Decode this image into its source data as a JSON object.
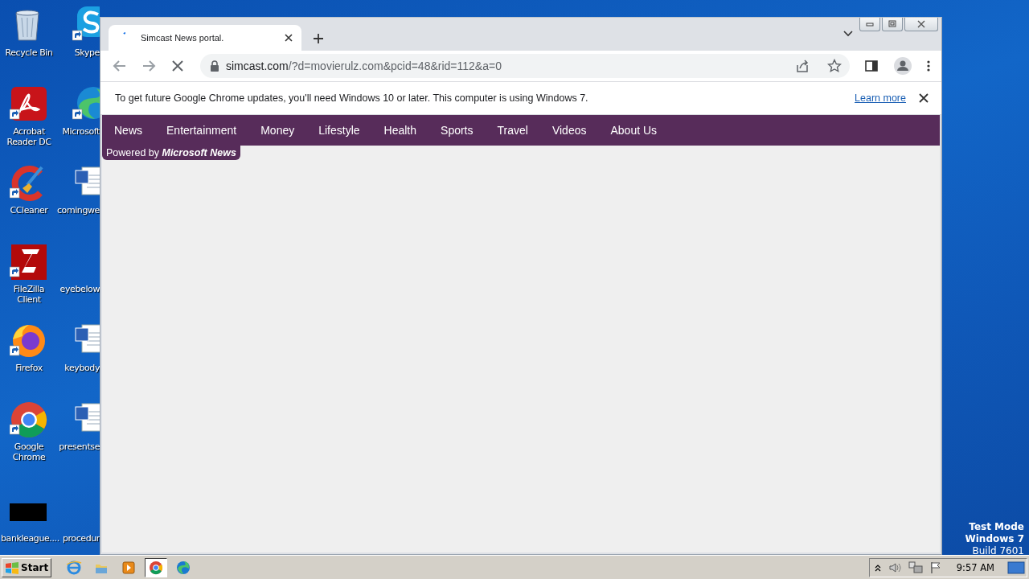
{
  "desktop_icons": [
    {
      "label": "Recycle Bin",
      "shortcut": false
    },
    {
      "label": "Acrobat Reader DC",
      "shortcut": true
    },
    {
      "label": "CCleaner",
      "shortcut": true
    },
    {
      "label": "FileZilla Client",
      "shortcut": true
    },
    {
      "label": "Firefox",
      "shortcut": true
    },
    {
      "label": "Google Chrome",
      "shortcut": true
    },
    {
      "label": "bankleague....",
      "shortcut": false
    },
    {
      "label": "Skype",
      "shortcut": true
    },
    {
      "label": "Microsoft",
      "shortcut": true
    },
    {
      "label": "comingwe",
      "shortcut": false
    },
    {
      "label": "eyebelow"
    },
    {
      "label": "keybody",
      "shortcut": false
    },
    {
      "label": "presentse",
      "shortcut": false
    },
    {
      "label": "procedur"
    }
  ],
  "browser": {
    "tabs": [
      {
        "title": "Simcast News portal.",
        "selected": true,
        "loading": true
      }
    ],
    "address": {
      "host": "simcast.com",
      "path": "/?d=movierulz.com&pcid=48&rid=112&a=0"
    },
    "infobar": {
      "message": "To get future Google Chrome updates, you'll need Windows 10 or later. This computer is using Windows 7.",
      "link": "Learn more"
    },
    "page": {
      "nav": [
        "News",
        "Entertainment",
        "Money",
        "Lifestyle",
        "Health",
        "Sports",
        "Travel",
        "Videos",
        "About Us"
      ],
      "powered_by": "Powered by **Microsoft News**"
    }
  },
  "desktop_notice": [
    "Test Mode",
    "Windows 7",
    "Build 7601"
  ],
  "taskbar": {
    "start": "Start",
    "pinned": [
      {
        "selected": false
      },
      {
        "selected": false
      },
      {
        "selected": false
      },
      {
        "selected": true
      },
      {
        "selected": false
      }
    ],
    "clock": "9:57 AM"
  }
}
